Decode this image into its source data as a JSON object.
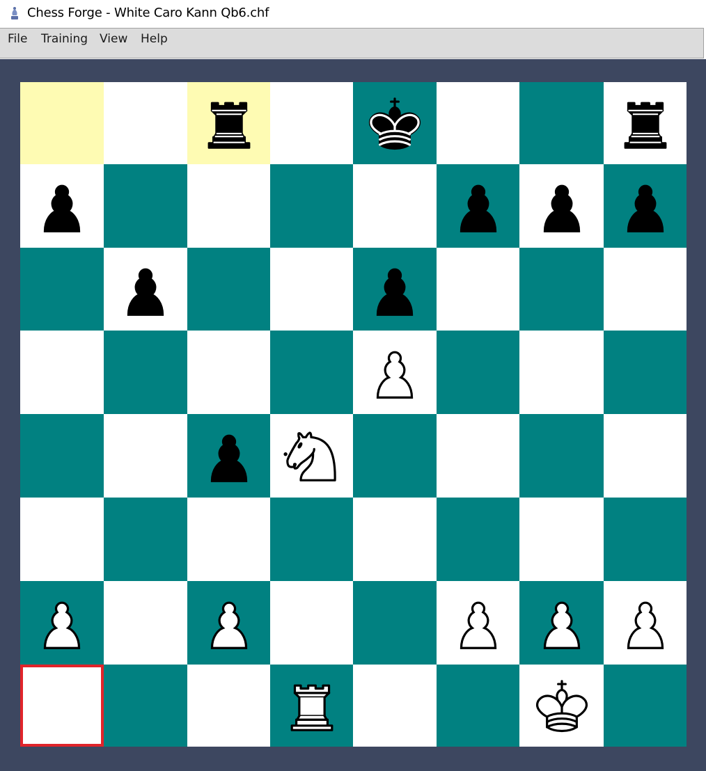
{
  "window": {
    "title": "Chess Forge - White Caro Kann Qb6.chf",
    "app_icon": "chess-bishop-icon"
  },
  "menu": {
    "items": [
      "File",
      "Training",
      "View",
      "Help"
    ]
  },
  "board": {
    "orientation": "white-bottom",
    "colors": {
      "light": "#ffffff",
      "dark": "#018181",
      "last_move": "#fefbb3",
      "selection": "#e0242a",
      "frame": "#3d4760"
    },
    "last_move": [
      "a8",
      "c8"
    ],
    "selected_square": "a1",
    "pieces": {
      "c8": "bR",
      "e8": "bK",
      "h8": "bR",
      "a7": "bP",
      "f7": "bP",
      "g7": "bP",
      "h7": "bP",
      "b6": "bP",
      "e6": "bP",
      "e5": "wP",
      "c4": "bP",
      "d4": "wN",
      "a2": "wP",
      "c2": "wP",
      "f2": "wP",
      "g2": "wP",
      "h2": "wP",
      "d1": "wR",
      "g1": "wK"
    }
  }
}
